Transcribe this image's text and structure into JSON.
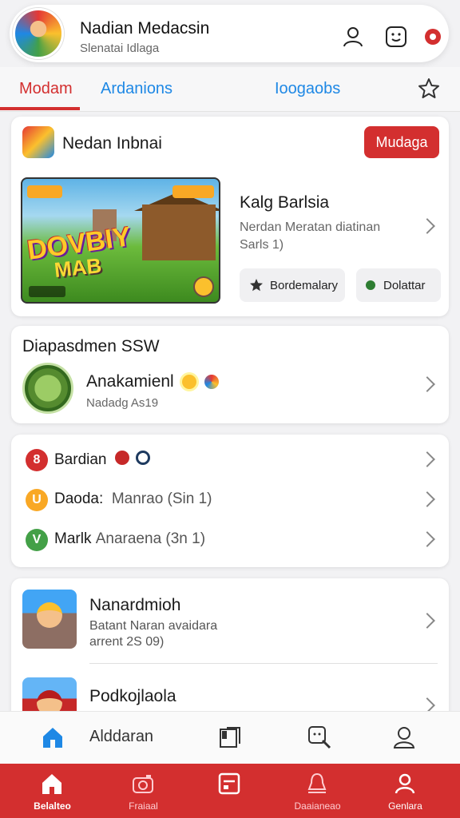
{
  "header": {
    "title": "Nadian Medacsin",
    "subtitle": "Slenatai Idlaga",
    "icons": [
      "profile-icon",
      "smile-face-icon",
      "notification-icon"
    ]
  },
  "tabs": [
    {
      "label": "Modam",
      "active": true
    },
    {
      "label": "Ardanions",
      "active": false
    },
    {
      "label": "Ioogaobs",
      "active": false
    }
  ],
  "featured": {
    "title": "Nedan Inbnai",
    "button": "Mudaga",
    "banner_logo": "DOVBIY",
    "banner_sub": "MAB",
    "game_title": "Kalg Barlsia",
    "game_desc": "Nerdan Meratan diatinan Sarls 1)",
    "pill_1": "Bordemalary",
    "pill_2": "Dolattar"
  },
  "section2": {
    "title": "Diapasdmen SSW",
    "item_name": "Anakamienl",
    "item_sub": "Nadadg As19"
  },
  "list": [
    {
      "icon_letter": "8",
      "color": "#d32f2f",
      "name": "Bardian",
      "detail": ""
    },
    {
      "icon_letter": "U",
      "color": "#f9a825",
      "name": "Daoda:",
      "detail": "Manrao (Sin 1)"
    },
    {
      "icon_letter": "V",
      "color": "#43a047",
      "name": "Marlk",
      "detail": "Anaraena (3n 1)"
    }
  ],
  "section4": {
    "title": "Nanardmioh",
    "desc_line1": "Batant Naran avaidara",
    "desc_line2": "arrent 2S 09)",
    "title2": "Podkojlaola"
  },
  "toolbar": {
    "label": "Alddaran"
  },
  "bottom_nav": [
    {
      "label": "Belalteo",
      "icon": "home-icon",
      "active": true
    },
    {
      "label": "Fraiaal",
      "icon": "camera-icon",
      "active": false
    },
    {
      "label": "",
      "icon": "document-icon",
      "active": false
    },
    {
      "label": "Daaianeao",
      "icon": "bell-icon",
      "active": false
    },
    {
      "label": "Genlara",
      "icon": "person-icon",
      "active": false
    }
  ],
  "colors": {
    "accent": "#d32f2f",
    "link_blue": "#1e88e5"
  }
}
